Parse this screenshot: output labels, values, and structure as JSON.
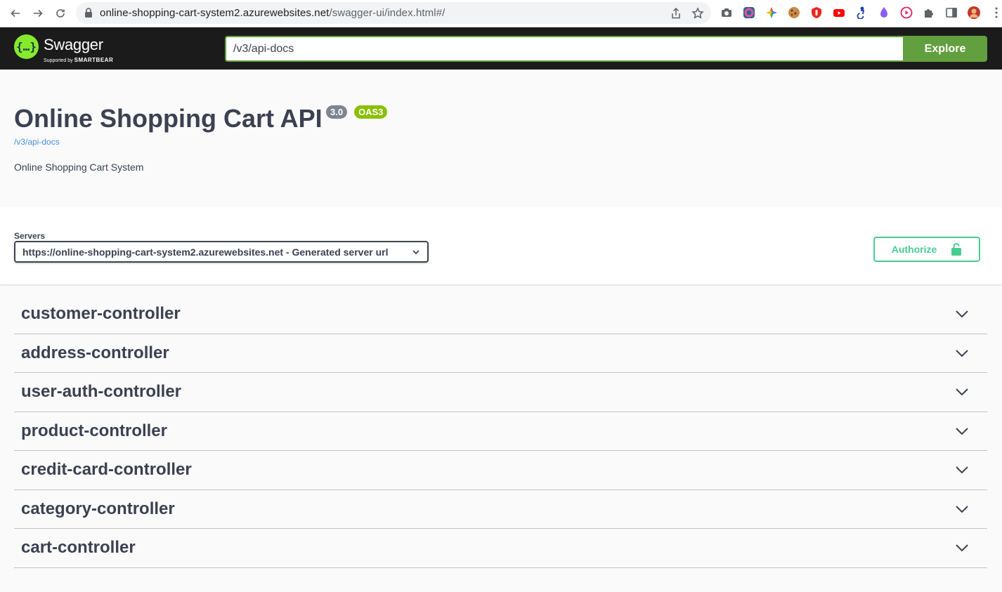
{
  "browser": {
    "url_host": "online-shopping-cart-system2.azurewebsites.net",
    "url_path": "/swagger-ui/index.html#/"
  },
  "topbar": {
    "logo_text": "Swagger",
    "logo_sub_prefix": "Supported by",
    "logo_sub_brand": "SMARTBEAR",
    "spec_url_value": "/v3/api-docs",
    "explore_label": "Explore"
  },
  "info": {
    "title": "Online Shopping Cart API",
    "version_badge": "3.0",
    "oas_badge": "OAS3",
    "spec_link": "/v3/api-docs",
    "description": "Online Shopping Cart System"
  },
  "servers": {
    "label": "Servers",
    "selected": "https://online-shopping-cart-system2.azurewebsites.net - Generated server url"
  },
  "authorize": {
    "label": "Authorize"
  },
  "tags": [
    {
      "name": "customer-controller"
    },
    {
      "name": "address-controller"
    },
    {
      "name": "user-auth-controller"
    },
    {
      "name": "product-controller"
    },
    {
      "name": "credit-card-controller"
    },
    {
      "name": "category-controller"
    },
    {
      "name": "cart-controller"
    }
  ],
  "colors": {
    "topbar_bg": "#1b1b1b",
    "explore_green": "#62a03f",
    "authorize_green": "#49cc90",
    "oas_badge": "#89bf04",
    "version_badge": "#7d8492",
    "text": "#3b4151"
  }
}
